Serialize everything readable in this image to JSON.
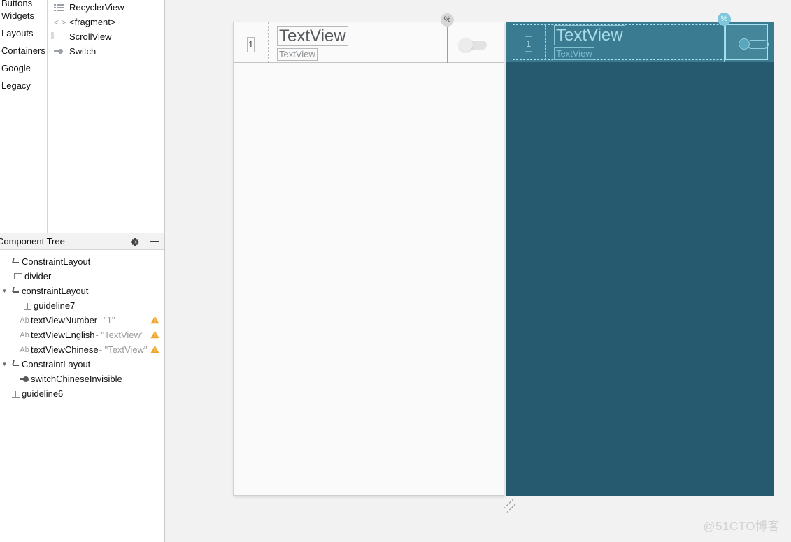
{
  "palette": {
    "categories": [
      {
        "label": "Buttons",
        "clipped": true
      },
      {
        "label": "Widgets",
        "clipped": false
      },
      {
        "label": "Layouts",
        "clipped": false
      },
      {
        "label": "Containers",
        "clipped": false
      },
      {
        "label": "Google",
        "clipped": false
      },
      {
        "label": "Legacy",
        "clipped": false
      }
    ],
    "items": [
      {
        "label": "RecyclerView",
        "icon": "recyclerview-icon"
      },
      {
        "label": "<fragment>",
        "icon": "fragment-icon"
      },
      {
        "label": "ScrollView",
        "icon": "scrollview-icon"
      },
      {
        "label": "Switch",
        "icon": "switch-icon"
      }
    ]
  },
  "component_tree": {
    "title": "Component Tree",
    "actions": {
      "settings": "gear-icon",
      "minimize": "minimize-icon"
    },
    "nodes": [
      {
        "indent": 0,
        "arrow": "",
        "icon": "constraint-layout-icon",
        "label": "ConstraintLayout",
        "value": "",
        "warning": false
      },
      {
        "indent": 1,
        "arrow": "",
        "icon": "view-icon",
        "label": "divider",
        "value": "",
        "warning": false
      },
      {
        "indent": 0,
        "arrow": "▼",
        "icon": "constraint-layout-icon",
        "label": "constraintLayout",
        "value": "",
        "warning": false
      },
      {
        "indent": 2,
        "arrow": "",
        "icon": "guideline-icon",
        "label": "guideline7",
        "value": "",
        "warning": false
      },
      {
        "indent": 2,
        "arrow": "",
        "icon": "textview-icon",
        "label": "textViewNumber",
        "value": "- \"1\"",
        "warning": true
      },
      {
        "indent": 2,
        "arrow": "",
        "icon": "textview-icon",
        "label": "textViewEnglish",
        "value": "- \"TextView\"",
        "warning": true
      },
      {
        "indent": 2,
        "arrow": "",
        "icon": "textview-icon",
        "label": "textViewChinese",
        "value": "- \"TextView\"",
        "warning": true
      },
      {
        "indent": 0,
        "arrow": "▼",
        "icon": "constraint-layout-icon",
        "label": "ConstraintLayout",
        "value": "",
        "warning": false
      },
      {
        "indent": 2,
        "arrow": "",
        "icon": "switch-icon",
        "label": "switchChineseInvisible",
        "value": "",
        "warning": false
      },
      {
        "indent": 1,
        "arrow": "",
        "icon": "guideline-icon",
        "label": "guideline6",
        "value": "",
        "warning": false
      }
    ]
  },
  "design_surface": {
    "number_text": "1",
    "textview_large": "TextView",
    "textview_small": "TextView",
    "percent_badge": "%",
    "switch_state": "off"
  },
  "blueprint_surface": {
    "number_text": "1",
    "textview_large": "TextView",
    "textview_small": "TextView",
    "percent_badge": "%",
    "switch_state": "off"
  },
  "watermark": "@51CTO博客",
  "colors": {
    "blueprint_bg": "#265a6e",
    "blueprint_panel": "#3b7b91",
    "blueprint_subpanel": "#46869b",
    "blueprint_stroke": "#a8e2f0",
    "design_bg": "#fafafa",
    "canvas_bg": "#f2f2f2",
    "warning": "#f0a732"
  }
}
